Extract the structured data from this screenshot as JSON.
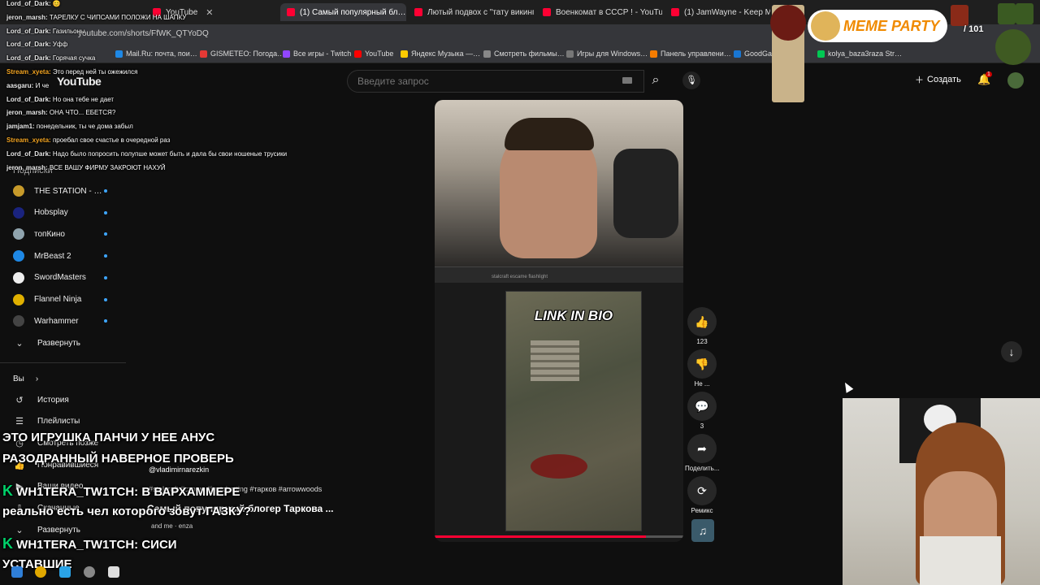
{
  "tabs": [
    {
      "label": "YouTube"
    },
    {
      "label": "(1) Самый популярный бл…"
    },
    {
      "label": "Лютый подвох с \"тату викингов\""
    },
    {
      "label": "Военкомат в СССР ! - YouTube"
    },
    {
      "label": "(1) JamWayne - Keep Moving"
    }
  ],
  "url": "youtube.com/shorts/FfWK_QTYoDQ",
  "bookmarks": [
    {
      "label": "Mail.Ru: почта, пои…",
      "color": "#1e88e5"
    },
    {
      "label": "GISMETEO: Погода…",
      "color": "#e53935"
    },
    {
      "label": "Все игры - Twitch",
      "color": "#9146ff"
    },
    {
      "label": "YouTube",
      "color": "#ff0000"
    },
    {
      "label": "Яндекс Музыка —…",
      "color": "#ffcc00"
    },
    {
      "label": "Смотреть фильмы…",
      "color": "#888888"
    },
    {
      "label": "Игры для Windows…",
      "color": "#777777"
    },
    {
      "label": "Панель управлени…",
      "color": "#f57c00"
    },
    {
      "label": "GoodGam…",
      "color": "#1976d2"
    },
    {
      "label": "kolya_baza3raza Str…",
      "color": "#00c853"
    }
  ],
  "header": {
    "logo": "YouTube",
    "search_placeholder": "Введите запрос",
    "create_label": "Создать",
    "notifications": "1"
  },
  "sidebar": {
    "subscriptions_title": "Подписки",
    "subscriptions": [
      {
        "name": "THE STATION - …",
        "color": "#c79a2a"
      },
      {
        "name": "Hobsplay",
        "color": "#1a237e"
      },
      {
        "name": "топКино",
        "color": "#90a4ae"
      },
      {
        "name": "MrBeast 2",
        "color": "#1e88e5"
      },
      {
        "name": "SwordMasters",
        "color": "#eeeeee"
      },
      {
        "name": "Flannel Ninja",
        "color": "#e0b000"
      },
      {
        "name": "Warhammer",
        "color": "#444444"
      }
    ],
    "expand_label": "Развернуть",
    "you_label": "Вы",
    "you_items": [
      "История",
      "Плейлисты",
      "Смотреть позже",
      "Понравившиеся",
      "Ваши видео",
      "Скачанные",
      "Развернуть"
    ]
  },
  "chat": [
    {
      "nick": "Lord_of_Dark:",
      "msg": "😊",
      "o": false
    },
    {
      "nick": "jeron_marsh:",
      "msg": "ТАРЕЛКУ С ЧИПСАМИ ПОЛОЖИ НА ШАПКУ",
      "o": false
    },
    {
      "nick": "Lord_of_Dark:",
      "msg": "Газильоны",
      "o": false
    },
    {
      "nick": "Lord_of_Dark:",
      "msg": "Уфф",
      "o": false
    },
    {
      "nick": "Lord_of_Dark:",
      "msg": "Горячая сучка",
      "o": false
    },
    {
      "nick": "Stream_xyeta:",
      "msg": "Это перед ней ты ожежился",
      "o": true
    },
    {
      "nick": "aasgaru:",
      "msg": "И че",
      "o": false
    },
    {
      "nick": "Lord_of_Dark:",
      "msg": "Но она тебе не дает",
      "o": false
    },
    {
      "nick": "jeron_marsh:",
      "msg": "ОНА ЧТО... ЕБЕТСЯ?",
      "o": false
    },
    {
      "nick": "jamjam1:",
      "msg": "понедельник, ты че дома забыл",
      "o": false
    },
    {
      "nick": "Stream_xyeta:",
      "msg": "проебал свое счастье в очередной раз",
      "o": true
    },
    {
      "nick": "Lord_of_Dark:",
      "msg": "Надо было попросить полупше может быть и дала бы свои ношеные трусики",
      "o": false
    },
    {
      "nick": "jeron_marsh:",
      "msg": "ВСЕ ВАШУ ФИРМУ ЗАКРОЮТ НАХУЙ",
      "o": false
    }
  ],
  "captions": [
    {
      "text": "ЭТО ИГРУШКА ПАНЧИ У НЕЕ АНУС",
      "badge": ""
    },
    {
      "text": "РАЗОДРАННЫЙ НАВЕРНОЕ ПРОВЕРЬ",
      "badge": ""
    },
    {
      "text": "WH1TERA_TW1TCH: В ВАРХАММЕРЕ",
      "badge": "K"
    },
    {
      "text": "реально есть чел которого зовут ГАЗКУ?",
      "badge": ""
    },
    {
      "text": "WH1TERA_TW1TCH: СИСИ",
      "badge": "K"
    },
    {
      "text": "УСТАВШИЕ",
      "badge": ""
    }
  ],
  "video": {
    "overlay_text": "LINK IN BIO",
    "game_search": "stalcraft escame flashlight",
    "channel": "@vladimirnarezkin",
    "description": "#stalcraft #стрим #justchatting #тарков #arrowwoods",
    "title": "Самый популярный блогер Таркова ...",
    "music": "and me · enza",
    "progress": 0.85
  },
  "actions": {
    "likes": "123",
    "dislike_label": "Не ...",
    "comments": "3",
    "share_label": "Поделить...",
    "remix_label": "Ремикс"
  },
  "overlay": {
    "meme_party": "MEME PARTY",
    "counter": "/ 101"
  },
  "colors": {
    "accent": "#ff0033",
    "link": "#3ea6ff",
    "chat_green": "#00d26a"
  }
}
